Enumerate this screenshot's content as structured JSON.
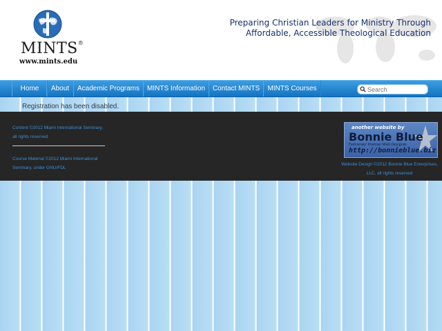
{
  "header": {
    "logo_text": "MINTS",
    "logo_registered": "®",
    "logo_url": "www.mints.edu",
    "tagline_line1": "Preparing Christian Leaders for Ministry Through",
    "tagline_line2": "Affordable, Accessible Theological Education"
  },
  "nav": {
    "items": [
      {
        "label": "Home"
      },
      {
        "label": "About"
      },
      {
        "label": "Academic Programs"
      },
      {
        "label": "MINTS Information"
      },
      {
        "label": "Contact MINTS"
      },
      {
        "label": "MINTS Courses"
      }
    ],
    "search_placeholder": "Search"
  },
  "main": {
    "message": "Registration has been disabled."
  },
  "footer": {
    "content_line1": "Content ©2012 Miami International Seminary,",
    "content_line2": "all rights reserved",
    "course_line1": "Course Material ©2012 Miami International",
    "course_line2": "Seminary, under GNU/FDL",
    "banner_line1": "another website by",
    "banner_line2": "Bonnie Blue",
    "banner_line3": "Felicienes' Premier Web Designer",
    "banner_line4": "http://bonnieblue.biz",
    "design_line1": "Website Design ©2012 Bonnie Blue Enterprises,",
    "design_line2": "LLC, all rights reserved"
  },
  "colors": {
    "nav_blue": "#1373c2",
    "footer_bg": "#262626",
    "link_blue": "#3a8fd9",
    "tagline": "#16306b"
  }
}
